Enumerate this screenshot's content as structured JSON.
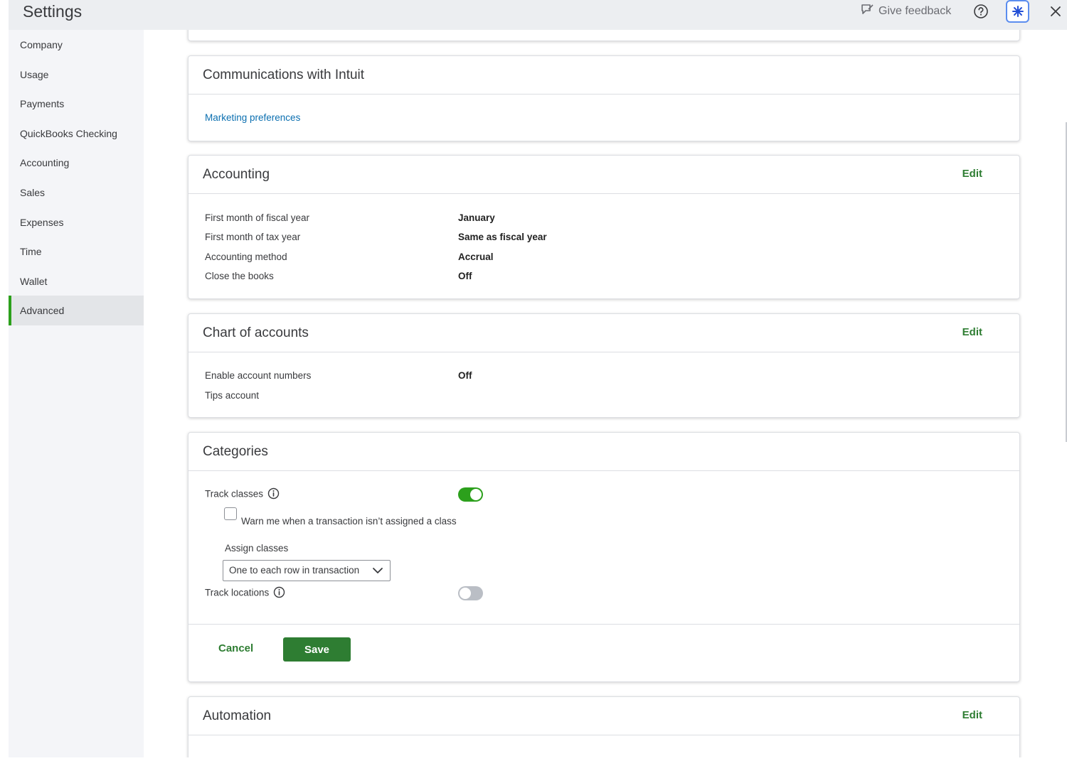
{
  "header": {
    "title": "Settings",
    "feedback_label": "Give feedback"
  },
  "sidebar": {
    "items": [
      {
        "label": "Company"
      },
      {
        "label": "Usage"
      },
      {
        "label": "Payments"
      },
      {
        "label": "QuickBooks Checking"
      },
      {
        "label": "Accounting"
      },
      {
        "label": "Sales"
      },
      {
        "label": "Expenses"
      },
      {
        "label": "Time"
      },
      {
        "label": "Wallet"
      },
      {
        "label": "Advanced",
        "active": true
      }
    ]
  },
  "communications": {
    "title": "Communications with Intuit",
    "link": "Marketing preferences"
  },
  "accounting": {
    "title": "Accounting",
    "edit": "Edit",
    "rows": [
      {
        "label": "First month of fiscal year",
        "value": "January"
      },
      {
        "label": "First month of tax year",
        "value": "Same as fiscal year"
      },
      {
        "label": "Accounting method",
        "value": "Accrual"
      },
      {
        "label": "Close the books",
        "value": "Off"
      }
    ]
  },
  "chart_of_accounts": {
    "title": "Chart of accounts",
    "edit": "Edit",
    "rows": [
      {
        "label": "Enable account numbers",
        "value": "Off"
      },
      {
        "label": "Tips account",
        "value": ""
      }
    ]
  },
  "categories": {
    "title": "Categories",
    "track_classes_label": "Track classes",
    "track_classes_on": true,
    "warn_label": "Warn me when a transaction isn’t assigned a class",
    "warn_checked": false,
    "assign_label": "Assign classes",
    "assign_value": "One to each row in transaction",
    "track_locations_label": "Track locations",
    "track_locations_on": false,
    "cancel_label": "Cancel",
    "save_label": "Save"
  },
  "automation": {
    "title": "Automation",
    "edit": "Edit"
  },
  "colors": {
    "accent_green": "#2ca01c",
    "button_green": "#2e7d32",
    "link_blue": "#0b6fb0"
  }
}
